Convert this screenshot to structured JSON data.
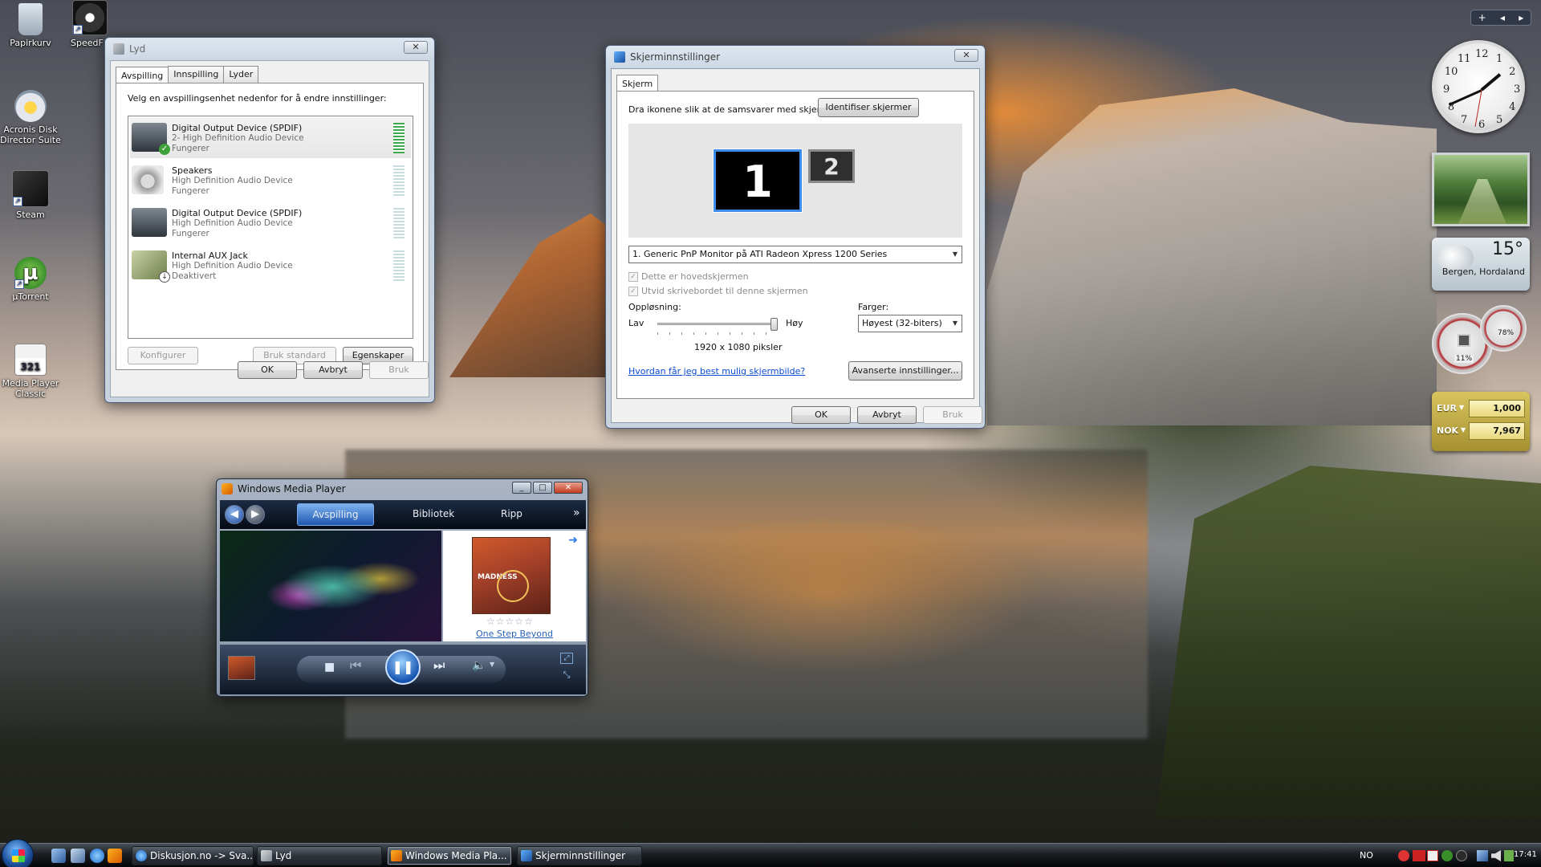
{
  "desktop": {
    "icons": [
      {
        "label": "Papirkurv",
        "icon": "recycle-bin-icon"
      },
      {
        "label": "SpeedF",
        "icon": "speedfan-icon"
      },
      {
        "label": "Acronis Disk Director Suite",
        "icon": "acronis-icon"
      },
      {
        "label": "Steam",
        "icon": "steam-icon"
      },
      {
        "label": "µTorrent",
        "icon": "utorrent-icon"
      },
      {
        "label": "Media Player Classic",
        "icon": "mpc-icon"
      }
    ]
  },
  "sound_dialog": {
    "title": "Lyd",
    "close": "✕",
    "tabs": [
      "Avspilling",
      "Innspilling",
      "Lyder"
    ],
    "instruction": "Velg en avspillingsenhet nedenfor for å endre innstillinger:",
    "devices": [
      {
        "name": "Digital Output Device (SPDIF)",
        "driver": "2- High Definition Audio Device",
        "status": "Fungerer",
        "default": true,
        "level_active": true
      },
      {
        "name": "Speakers",
        "driver": "High Definition Audio Device",
        "status": "Fungerer",
        "default": false,
        "level_active": false
      },
      {
        "name": "Digital Output Device (SPDIF)",
        "driver": "High Definition Audio Device",
        "status": "Fungerer",
        "default": false,
        "level_active": false
      },
      {
        "name": "Internal AUX Jack",
        "driver": "High Definition Audio Device",
        "status": "Deaktivert",
        "default": false,
        "level_active": false
      }
    ],
    "buttons": {
      "configure": "Konfigurer",
      "set_default": "Bruk standard",
      "properties": "Egenskaper",
      "ok": "OK",
      "cancel": "Avbryt",
      "apply": "Bruk"
    }
  },
  "display_dialog": {
    "title": "Skjerminnstillinger",
    "close": "✕",
    "tab": "Skjerm",
    "instruction": "Dra ikonene slik at de samsvarer med skjermene.",
    "identify_button": "Identifiser skjermer",
    "monitors": [
      "1",
      "2"
    ],
    "monitor_select": "1. Generic PnP Monitor på ATI Radeon Xpress 1200 Series",
    "checkbox_primary": "Dette er hovedskjermen",
    "checkbox_extend": "Utvid skrivebordet til denne skjermen",
    "resolution_label": "Oppløsning:",
    "low": "Lav",
    "high": "Høy",
    "resolution_value": "1920 x 1080 piksler",
    "resolution_slider_level": 1.0,
    "colors_label": "Farger:",
    "colors_value": "Høyest (32-biters)",
    "help_link": "Hvordan får jeg best mulig skjermbilde?",
    "advanced_button": "Avanserte innstillinger...",
    "buttons": {
      "ok": "OK",
      "cancel": "Avbryt",
      "apply": "Bruk"
    }
  },
  "media_player": {
    "title": "Windows Media Player",
    "tabs": [
      "Avspilling",
      "Bibliotek",
      "Ripp"
    ],
    "more": "»",
    "song": "One Step Beyond",
    "album_text": "MADNESS",
    "rating_stars": "☆☆☆☆☆",
    "controls": {
      "stop": "■",
      "prev": "⏮",
      "pause": "❚❚",
      "next": "⏭",
      "volume": "🔈"
    }
  },
  "gadgets": {
    "clock_numbers": [
      "12",
      "1",
      "2",
      "3",
      "4",
      "5",
      "6",
      "7",
      "8",
      "9",
      "10",
      "11"
    ],
    "weather_temp": "15°",
    "weather_city": "Bergen, Hordaland",
    "cpu_percent": "11%",
    "ram_percent": "78%",
    "currency": [
      {
        "code": "EUR",
        "value": "1,000"
      },
      {
        "code": "NOK",
        "value": "7,967"
      }
    ],
    "sidebar_controls": [
      "+",
      "◂",
      "▸"
    ]
  },
  "taskbar": {
    "tasks": [
      {
        "label": "Diskusjon.no -> Sva...",
        "icon": "ie-icon",
        "active": false
      },
      {
        "label": "Lyd",
        "icon": "speaker-icon",
        "active": false
      },
      {
        "label": "Windows Media Pla...",
        "icon": "wmp-icon",
        "active": true
      },
      {
        "label": "Skjerminnstillinger",
        "icon": "display-icon",
        "active": false
      }
    ],
    "language": "NO",
    "time": "17:41"
  },
  "colors": {
    "accent": "#1d56ad",
    "link": "#0b4bd4",
    "meter_active": "#3fa84a"
  }
}
